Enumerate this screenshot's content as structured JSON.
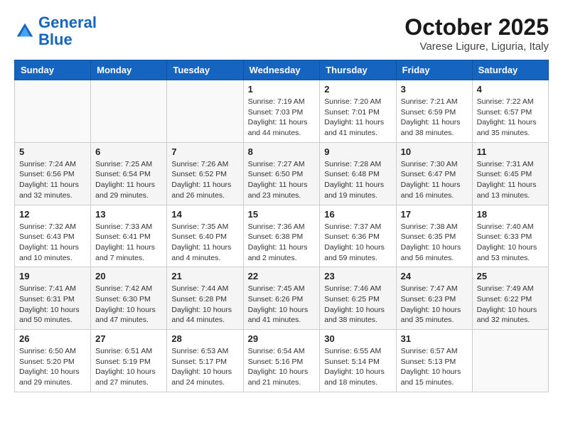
{
  "header": {
    "logo_line1": "General",
    "logo_line2": "Blue",
    "month_title": "October 2025",
    "location": "Varese Ligure, Liguria, Italy"
  },
  "days_of_week": [
    "Sunday",
    "Monday",
    "Tuesday",
    "Wednesday",
    "Thursday",
    "Friday",
    "Saturday"
  ],
  "weeks": [
    [
      {
        "day": "",
        "empty": true
      },
      {
        "day": "",
        "empty": true
      },
      {
        "day": "",
        "empty": true
      },
      {
        "day": "1",
        "sunrise": "7:19 AM",
        "sunset": "7:03 PM",
        "daylight": "11 hours and 44 minutes."
      },
      {
        "day": "2",
        "sunrise": "7:20 AM",
        "sunset": "7:01 PM",
        "daylight": "11 hours and 41 minutes."
      },
      {
        "day": "3",
        "sunrise": "7:21 AM",
        "sunset": "6:59 PM",
        "daylight": "11 hours and 38 minutes."
      },
      {
        "day": "4",
        "sunrise": "7:22 AM",
        "sunset": "6:57 PM",
        "daylight": "11 hours and 35 minutes."
      }
    ],
    [
      {
        "day": "5",
        "sunrise": "7:24 AM",
        "sunset": "6:56 PM",
        "daylight": "11 hours and 32 minutes."
      },
      {
        "day": "6",
        "sunrise": "7:25 AM",
        "sunset": "6:54 PM",
        "daylight": "11 hours and 29 minutes."
      },
      {
        "day": "7",
        "sunrise": "7:26 AM",
        "sunset": "6:52 PM",
        "daylight": "11 hours and 26 minutes."
      },
      {
        "day": "8",
        "sunrise": "7:27 AM",
        "sunset": "6:50 PM",
        "daylight": "11 hours and 23 minutes."
      },
      {
        "day": "9",
        "sunrise": "7:28 AM",
        "sunset": "6:48 PM",
        "daylight": "11 hours and 19 minutes."
      },
      {
        "day": "10",
        "sunrise": "7:30 AM",
        "sunset": "6:47 PM",
        "daylight": "11 hours and 16 minutes."
      },
      {
        "day": "11",
        "sunrise": "7:31 AM",
        "sunset": "6:45 PM",
        "daylight": "11 hours and 13 minutes."
      }
    ],
    [
      {
        "day": "12",
        "sunrise": "7:32 AM",
        "sunset": "6:43 PM",
        "daylight": "11 hours and 10 minutes."
      },
      {
        "day": "13",
        "sunrise": "7:33 AM",
        "sunset": "6:41 PM",
        "daylight": "11 hours and 7 minutes."
      },
      {
        "day": "14",
        "sunrise": "7:35 AM",
        "sunset": "6:40 PM",
        "daylight": "11 hours and 4 minutes."
      },
      {
        "day": "15",
        "sunrise": "7:36 AM",
        "sunset": "6:38 PM",
        "daylight": "11 hours and 2 minutes."
      },
      {
        "day": "16",
        "sunrise": "7:37 AM",
        "sunset": "6:36 PM",
        "daylight": "10 hours and 59 minutes."
      },
      {
        "day": "17",
        "sunrise": "7:38 AM",
        "sunset": "6:35 PM",
        "daylight": "10 hours and 56 minutes."
      },
      {
        "day": "18",
        "sunrise": "7:40 AM",
        "sunset": "6:33 PM",
        "daylight": "10 hours and 53 minutes."
      }
    ],
    [
      {
        "day": "19",
        "sunrise": "7:41 AM",
        "sunset": "6:31 PM",
        "daylight": "10 hours and 50 minutes."
      },
      {
        "day": "20",
        "sunrise": "7:42 AM",
        "sunset": "6:30 PM",
        "daylight": "10 hours and 47 minutes."
      },
      {
        "day": "21",
        "sunrise": "7:44 AM",
        "sunset": "6:28 PM",
        "daylight": "10 hours and 44 minutes."
      },
      {
        "day": "22",
        "sunrise": "7:45 AM",
        "sunset": "6:26 PM",
        "daylight": "10 hours and 41 minutes."
      },
      {
        "day": "23",
        "sunrise": "7:46 AM",
        "sunset": "6:25 PM",
        "daylight": "10 hours and 38 minutes."
      },
      {
        "day": "24",
        "sunrise": "7:47 AM",
        "sunset": "6:23 PM",
        "daylight": "10 hours and 35 minutes."
      },
      {
        "day": "25",
        "sunrise": "7:49 AM",
        "sunset": "6:22 PM",
        "daylight": "10 hours and 32 minutes."
      }
    ],
    [
      {
        "day": "26",
        "sunrise": "6:50 AM",
        "sunset": "5:20 PM",
        "daylight": "10 hours and 29 minutes."
      },
      {
        "day": "27",
        "sunrise": "6:51 AM",
        "sunset": "5:19 PM",
        "daylight": "10 hours and 27 minutes."
      },
      {
        "day": "28",
        "sunrise": "6:53 AM",
        "sunset": "5:17 PM",
        "daylight": "10 hours and 24 minutes."
      },
      {
        "day": "29",
        "sunrise": "6:54 AM",
        "sunset": "5:16 PM",
        "daylight": "10 hours and 21 minutes."
      },
      {
        "day": "30",
        "sunrise": "6:55 AM",
        "sunset": "5:14 PM",
        "daylight": "10 hours and 18 minutes."
      },
      {
        "day": "31",
        "sunrise": "6:57 AM",
        "sunset": "5:13 PM",
        "daylight": "10 hours and 15 minutes."
      },
      {
        "day": "",
        "empty": true
      }
    ]
  ],
  "labels": {
    "sunrise": "Sunrise:",
    "sunset": "Sunset:",
    "daylight": "Daylight:"
  }
}
